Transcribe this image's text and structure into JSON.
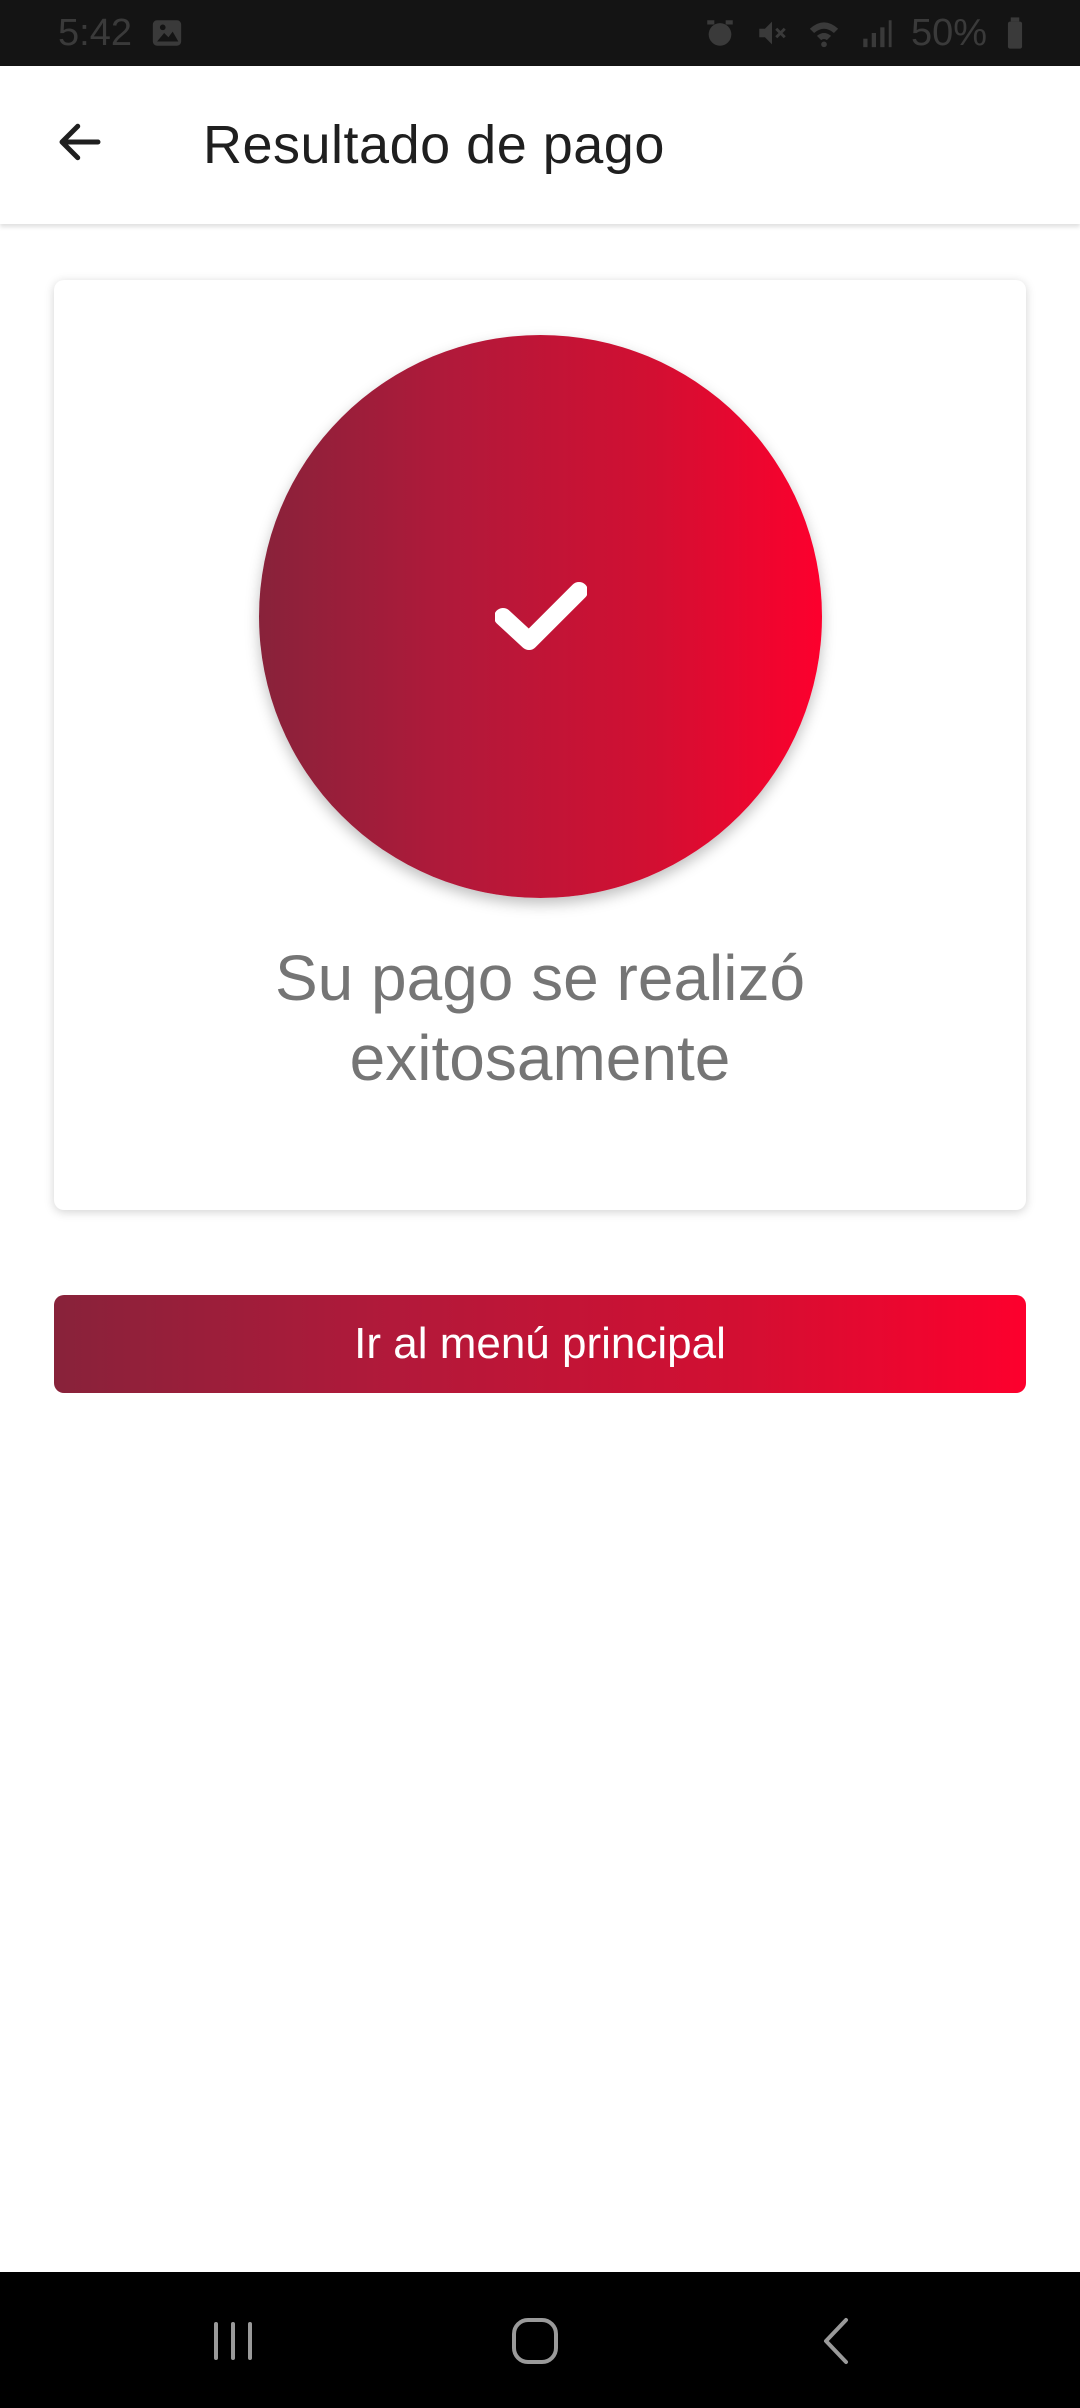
{
  "status_bar": {
    "time": "5:42",
    "battery": "50%",
    "icons": [
      "gallery-icon",
      "alarm-icon",
      "mute-icon",
      "wifi-icon",
      "signal-icon",
      "battery-icon"
    ]
  },
  "app_bar": {
    "title": "Resultado de pago",
    "back_icon": "arrow-left-icon"
  },
  "result_card": {
    "icon": "check-icon",
    "message": "Su pago se realizó exitosamente"
  },
  "actions": {
    "main_menu_label": "Ir al menú principal"
  },
  "nav_bar": {
    "icons": [
      "recent-apps-icon",
      "home-icon",
      "back-icon"
    ]
  },
  "colors": {
    "gradient_start": "#88223a",
    "gradient_end": "#fd002d",
    "message_text": "#757575",
    "title_text": "#1f1f1f"
  }
}
